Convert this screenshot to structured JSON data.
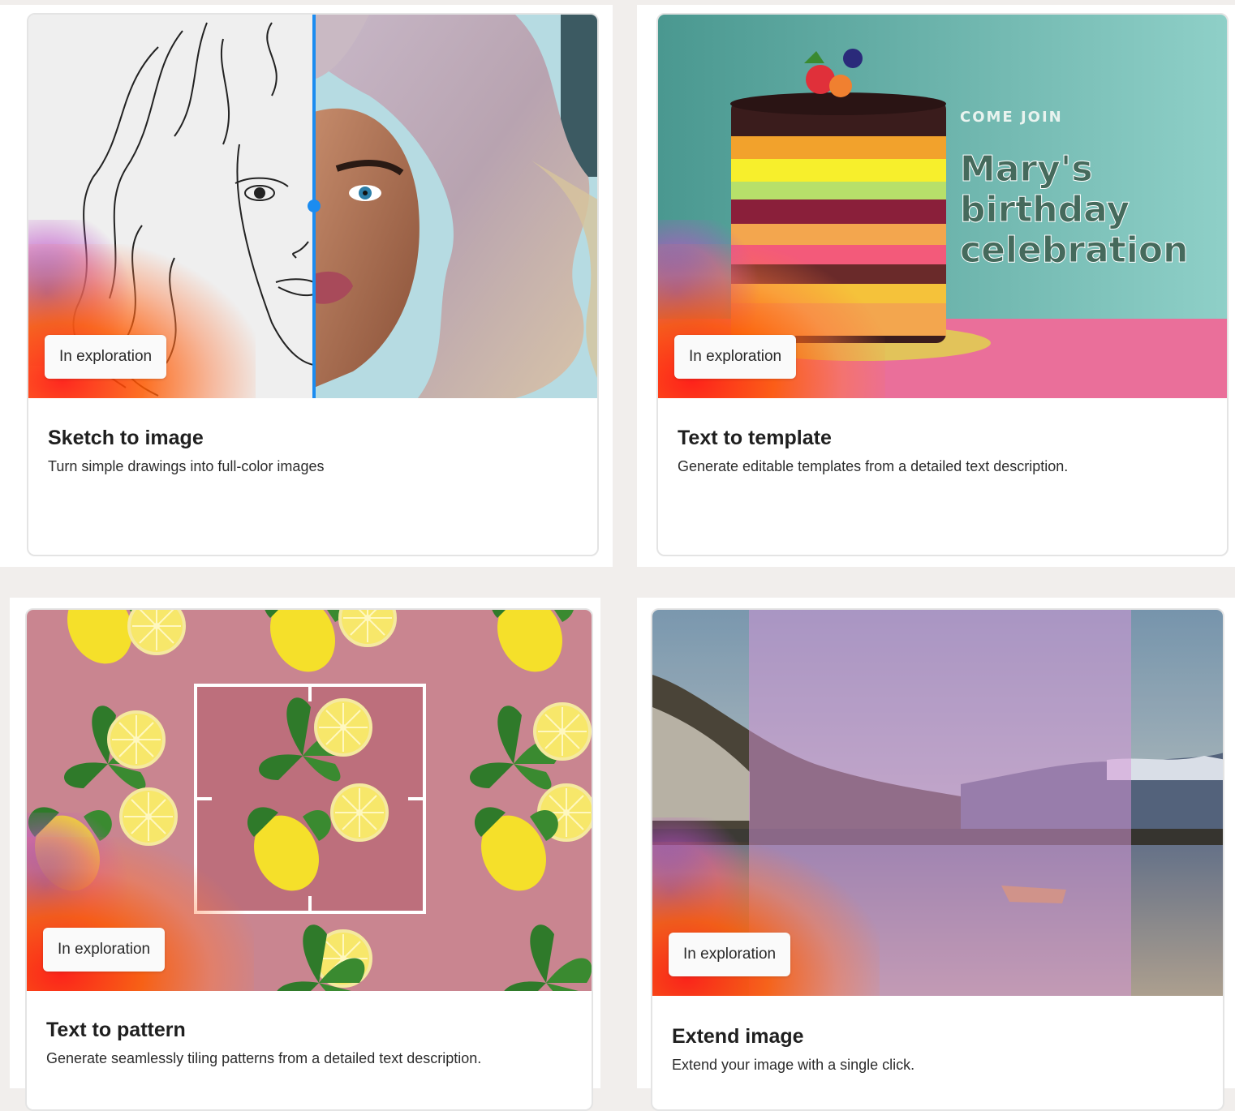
{
  "cards": [
    {
      "title": "Sketch to image",
      "description": "Turn simple drawings into full-color images",
      "badge": "In exploration"
    },
    {
      "title": "Text to template",
      "description": "Generate editable templates from a detailed text description.",
      "badge": "In exploration",
      "template_text": {
        "kicker": "COME JOIN",
        "line1": "Mary's",
        "line2": "birthday",
        "line3": "celebration"
      }
    },
    {
      "title": "Text to pattern",
      "description": "Generate seamlessly tiling patterns from a detailed text description.",
      "badge": "In exploration"
    },
    {
      "title": "Extend image",
      "description": "Extend your image with a single click.",
      "badge": "In exploration"
    }
  ],
  "colors": {
    "page_bg": "#f1eeec",
    "slider_accent": "#1b8cf0",
    "badge_bg": "#fafafa"
  }
}
